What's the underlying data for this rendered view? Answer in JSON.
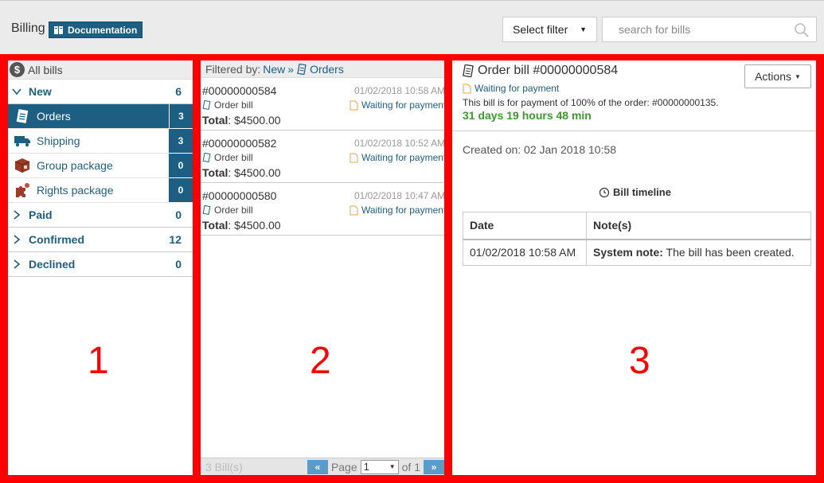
{
  "header": {
    "title": "Billing",
    "doc_button": "Documentation",
    "filter_select": "Select filter",
    "search_placeholder": "search for bills"
  },
  "panel_labels": [
    "1",
    "2",
    "3"
  ],
  "sidebar": {
    "all_bills": "All bills",
    "groups": [
      {
        "label": "New",
        "count": "6",
        "expanded": true,
        "items": [
          {
            "label": "Orders",
            "count": "3",
            "icon": "bill-icon",
            "active": true
          },
          {
            "label": "Shipping",
            "count": "3",
            "icon": "truck-icon"
          },
          {
            "label": "Group package",
            "count": "0",
            "icon": "package-icon"
          },
          {
            "label": "Rights package",
            "count": "0",
            "icon": "puzzle-icon"
          }
        ]
      },
      {
        "label": "Paid",
        "count": "0"
      },
      {
        "label": "Confirmed",
        "count": "12"
      },
      {
        "label": "Declined",
        "count": "0"
      }
    ]
  },
  "list": {
    "filtered_by": "Filtered by:",
    "filter_new": "New",
    "filter_sep": "»",
    "filter_orders": "Orders",
    "bills": [
      {
        "number": "#00000000584",
        "date": "01/02/2018 10:58 AM",
        "type": "Order bill",
        "status": "Waiting for payment",
        "total_label": "Total",
        "total": ": $4500.00"
      },
      {
        "number": "#00000000582",
        "date": "01/02/2018 10:52 AM",
        "type": "Order bill",
        "status": "Waiting for payment",
        "total_label": "Total",
        "total": ": $4500.00"
      },
      {
        "number": "#00000000580",
        "date": "01/02/2018 10:47 AM",
        "type": "Order bill",
        "status": "Waiting for payment",
        "total_label": "Total",
        "total": ": $4500.00"
      }
    ],
    "pager": {
      "count": "3 Bill(s)",
      "page_label": "Page",
      "page": "1",
      "of_label": "of 1"
    }
  },
  "detail": {
    "title": "Order bill #00000000584",
    "status": "Waiting for payment",
    "description": "This bill is for payment of 100% of the order: #00000000135.",
    "time_left": "31 days 19 hours 48 min",
    "actions": "Actions",
    "created": "Created on: 02 Jan 2018 10:58",
    "timeline_title": "Bill timeline",
    "timeline": {
      "headers": [
        "Date",
        "Note(s)"
      ],
      "rows": [
        {
          "date": "01/02/2018 10:58 AM",
          "note_label": "System note:",
          "note": " The bill has been created."
        }
      ]
    }
  },
  "colors": {
    "accent": "#1d5f82",
    "highlight": "#ff0000",
    "success": "#3c9a2e"
  }
}
